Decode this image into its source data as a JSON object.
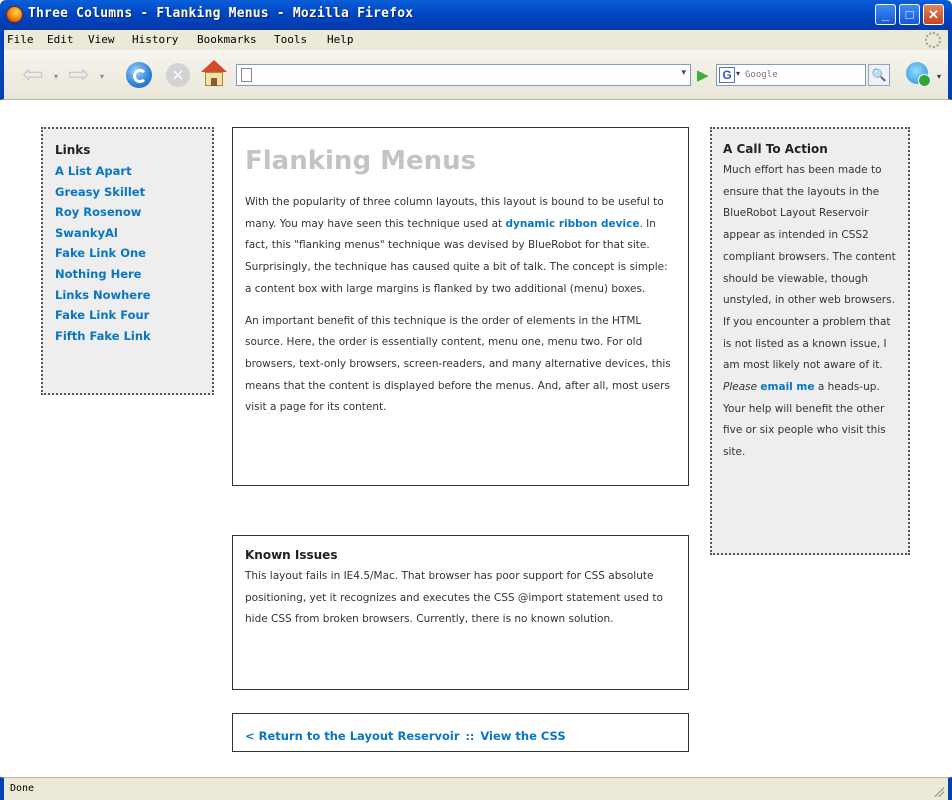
{
  "window": {
    "title": "Three Columns - Flanking Menus - Mozilla Firefox",
    "min_glyph": "_",
    "max_glyph": "□",
    "close_glyph": "✕"
  },
  "menubar": {
    "items": [
      "File",
      "Edit",
      "View",
      "History",
      "Bookmarks",
      "Tools",
      "Help"
    ]
  },
  "toolbar": {
    "url_value": "",
    "search_placeholder": "Google",
    "search_engine_glyph": "G",
    "back_glyph": "⇦",
    "forward_glyph": "⇨",
    "stop_glyph": "×",
    "go_glyph": "▶",
    "dropdown_glyph": "▾",
    "search_button_glyph": "🔍"
  },
  "left_menu": {
    "heading": "Links",
    "links": [
      "A List Apart",
      "Greasy Skillet",
      "Roy Rosenow",
      "SwankyAl",
      "Fake Link One",
      "Nothing Here",
      "Links Nowhere",
      "Fake Link Four",
      "Fifth Fake Link"
    ]
  },
  "main": {
    "title": "Flanking Menus",
    "p1_before": "With the popularity of three column layouts, this layout is bound to be useful to many. You may have seen this technique used at ",
    "p1_link": "dynamic ribbon device",
    "p1_after": ". In fact, this \"flanking menus\" technique was devised by BlueRobot for that site. Surprisingly, the technique has caused quite a bit of talk. The concept is simple: a content box with large margins is flanked by two additional (menu) boxes.",
    "p2": "An important benefit of this technique is the order of elements in the HTML source. Here, the order is essentially content, menu one, menu two. For old browsers, text-only browsers, screen-readers, and many alternative devices, this means that the content is displayed before the menus. And, after all, most users visit a page for its content."
  },
  "issues": {
    "heading": "Known Issues",
    "text": "This layout fails in IE4.5/Mac. That browser has poor support for CSS absolute positioning, yet it recognizes and executes the CSS @import statement used to hide CSS from broken browsers. Currently, there is no known solution."
  },
  "footer": {
    "return_link": "< Return to the Layout Reservoir",
    "separator": "::",
    "css_link": "View the CSS"
  },
  "right_menu": {
    "heading": "A Call To Action",
    "text_before": "Much effort has been made to ensure that the layouts in the BlueRobot Layout Reservoir appear as intended in CSS2 compliant browsers. The content should be viewable, though unstyled, in other web browsers. If you encounter a problem that is not listed as a known issue, I am most likely not aware of it. ",
    "text_italic": "Please",
    "text_link": "email me",
    "text_after": " a heads-up. Your help will benefit the other five or six people who visit this site."
  },
  "status": {
    "text": "Done"
  },
  "colors": {
    "link": "#0976c2",
    "title_gray": "#c3c3c3",
    "menu_bg": "#eeeeee",
    "xp_blue": "#0043b8"
  }
}
